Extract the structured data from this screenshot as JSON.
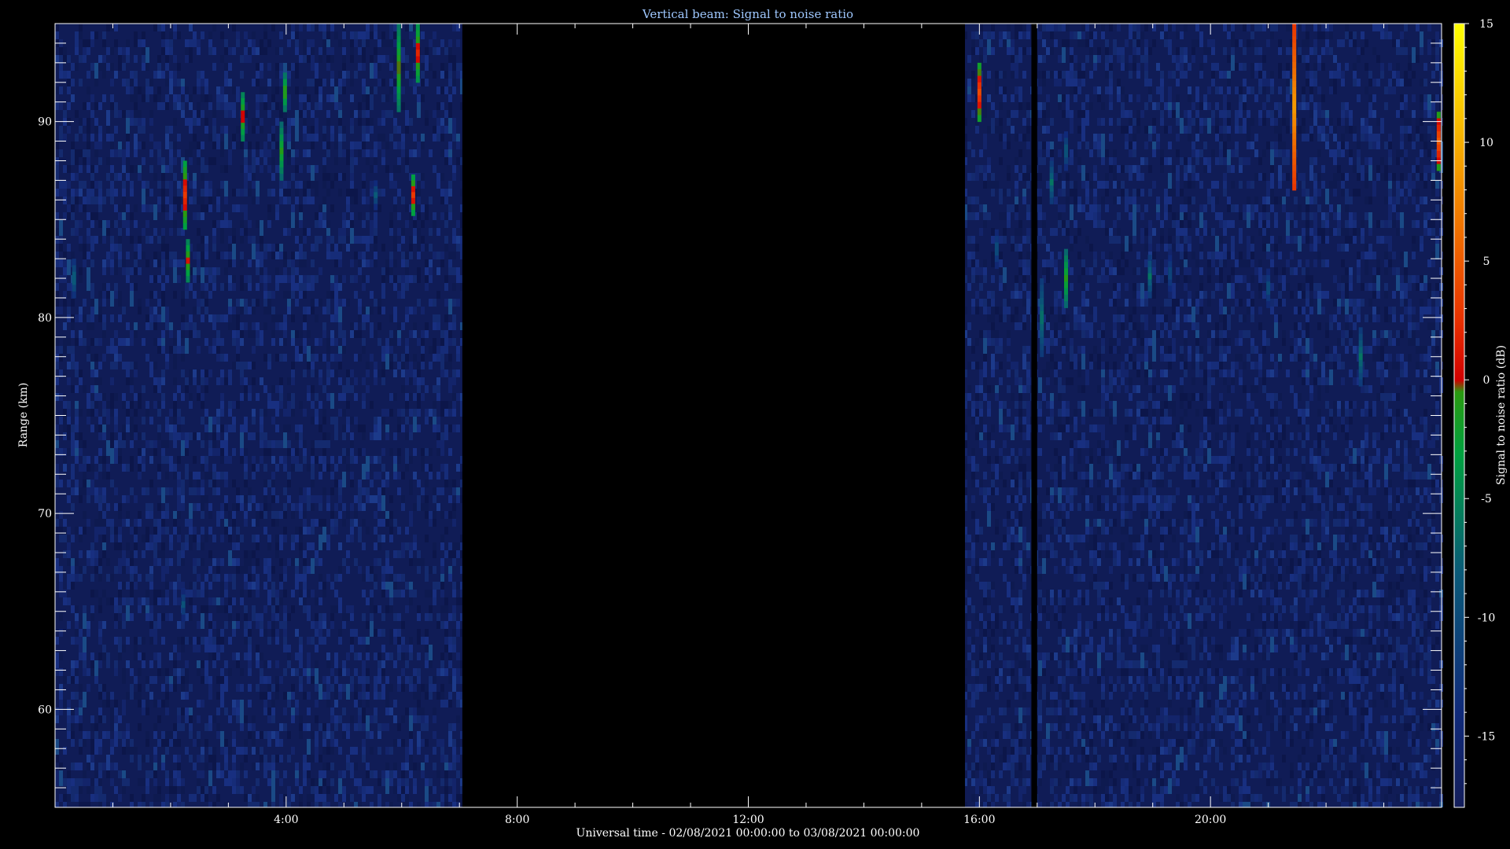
{
  "chart_data": {
    "type": "heatmap",
    "title": "Vertical beam: Signal to noise ratio",
    "xlabel": "Universal time - 02/08/2021 00:00:00 to 03/08/2021 00:00:00",
    "ylabel": "Range (km)",
    "colorbar_label": "Signal to noise ratio (dB)",
    "xlim_hours": [
      0,
      24
    ],
    "ylim_km": [
      55,
      95
    ],
    "clim_db": [
      -18,
      15
    ],
    "x_ticks": [
      {
        "hour": 4,
        "label": "4:00"
      },
      {
        "hour": 8,
        "label": "8:00"
      },
      {
        "hour": 12,
        "label": "12:00"
      },
      {
        "hour": 16,
        "label": "16:00"
      },
      {
        "hour": 20,
        "label": "20:00"
      }
    ],
    "y_ticks": [
      {
        "km": 60,
        "label": "60"
      },
      {
        "km": 70,
        "label": "70"
      },
      {
        "km": 80,
        "label": "80"
      },
      {
        "km": 90,
        "label": "90"
      }
    ],
    "colorbar_ticks": [
      {
        "db": 15,
        "label": "15"
      },
      {
        "db": 10,
        "label": "10"
      },
      {
        "db": 5,
        "label": "5"
      },
      {
        "db": 0,
        "label": "0"
      },
      {
        "db": -5,
        "label": "-5"
      },
      {
        "db": -10,
        "label": "-10"
      },
      {
        "db": -15,
        "label": "-15"
      }
    ],
    "data_gaps_hours": [
      [
        7.05,
        15.75
      ],
      [
        16.9,
        17.0
      ]
    ],
    "background_db": -16,
    "strong_echoes": [
      {
        "hour": 0.33,
        "km_start": 81.0,
        "km_end": 83.0,
        "db": -7
      },
      {
        "hour": 2.25,
        "km_start": 84.5,
        "km_end": 88.0,
        "db": 3
      },
      {
        "hour": 2.3,
        "km_start": 81.8,
        "km_end": 84.0,
        "db": 1
      },
      {
        "hour": 2.22,
        "km_start": 64.5,
        "km_end": 66.2,
        "db": -9
      },
      {
        "hour": 3.25,
        "km_start": 89.0,
        "km_end": 91.5,
        "db": 1
      },
      {
        "hour": 3.92,
        "km_start": 87.0,
        "km_end": 90.0,
        "db": -1
      },
      {
        "hour": 3.98,
        "km_start": 90.5,
        "km_end": 92.5,
        "db": 0
      },
      {
        "hour": 5.55,
        "km_start": 85.5,
        "km_end": 87.0,
        "db": -8
      },
      {
        "hour": 5.95,
        "km_start": 90.5,
        "km_end": 95.0,
        "db": 0
      },
      {
        "hour": 6.2,
        "km_start": 85.2,
        "km_end": 87.3,
        "db": 3
      },
      {
        "hour": 6.28,
        "km_start": 92.0,
        "km_end": 95.0,
        "db": 2
      },
      {
        "hour": 16.0,
        "km_start": 90.0,
        "km_end": 93.0,
        "db": 4
      },
      {
        "hour": 16.3,
        "km_start": 82.5,
        "km_end": 84.5,
        "db": -9
      },
      {
        "hour": 17.08,
        "km_start": 78.0,
        "km_end": 82.0,
        "db": -6
      },
      {
        "hour": 17.25,
        "km_start": 85.8,
        "km_end": 88.0,
        "db": -6
      },
      {
        "hour": 17.5,
        "km_start": 80.5,
        "km_end": 83.5,
        "db": -1
      },
      {
        "hour": 17.5,
        "km_start": 87.5,
        "km_end": 89.5,
        "db": -8
      },
      {
        "hour": 18.95,
        "km_start": 81.0,
        "km_end": 83.2,
        "db": -6
      },
      {
        "hour": 19.3,
        "km_start": 81.0,
        "km_end": 83.5,
        "db": -10
      },
      {
        "hour": 21.0,
        "km_start": 80.5,
        "km_end": 82.5,
        "db": -9
      },
      {
        "hour": 21.45,
        "km_start": 86.5,
        "km_end": 95.0,
        "db": 9
      },
      {
        "hour": 22.6,
        "km_start": 76.5,
        "km_end": 79.5,
        "db": -6
      },
      {
        "hour": 23.95,
        "km_start": 87.5,
        "km_end": 90.5,
        "db": 5
      }
    ]
  }
}
